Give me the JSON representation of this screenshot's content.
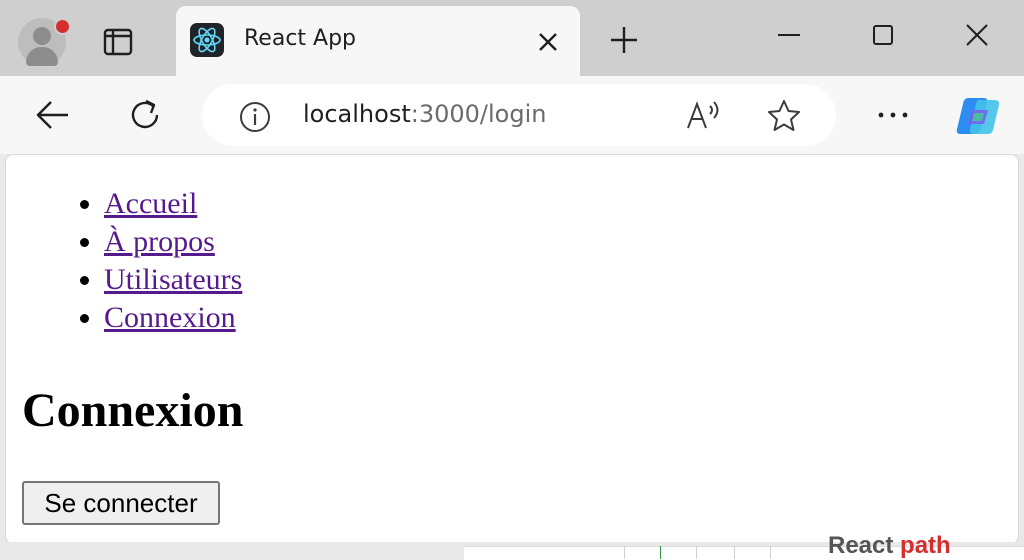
{
  "browser": {
    "tab": {
      "title": "React App",
      "favicon": "react-logo-icon"
    },
    "address_bar": {
      "host": "localhost",
      "path": ":3000/login"
    },
    "icons": {
      "profile": "profile-avatar-icon",
      "tab_actions": "tab-actions-icon",
      "close_tab": "close-icon",
      "new_tab": "plus-icon",
      "minimize": "minimize-icon",
      "maximize": "maximize-icon",
      "close_window": "close-icon",
      "back": "back-arrow-icon",
      "refresh": "refresh-icon",
      "site_info": "info-icon",
      "read_aloud": "read-aloud-icon",
      "favorite": "star-icon",
      "more": "more-icon",
      "copilot": "copilot-icon"
    },
    "colors": {
      "tab_bar": "#cfcfcf",
      "toolbar": "#f7f7f7",
      "notification_dot": "#d32f2f"
    }
  },
  "page": {
    "nav_links": [
      {
        "label": "Accueil"
      },
      {
        "label": "À propos"
      },
      {
        "label": "Utilisateurs"
      },
      {
        "label": "Connexion"
      }
    ],
    "heading": "Connexion",
    "login_button_label": "Se connecter",
    "link_color": "#551a8b"
  },
  "background_window": {
    "partial_text_main": "React",
    "partial_text_accent": "path"
  }
}
